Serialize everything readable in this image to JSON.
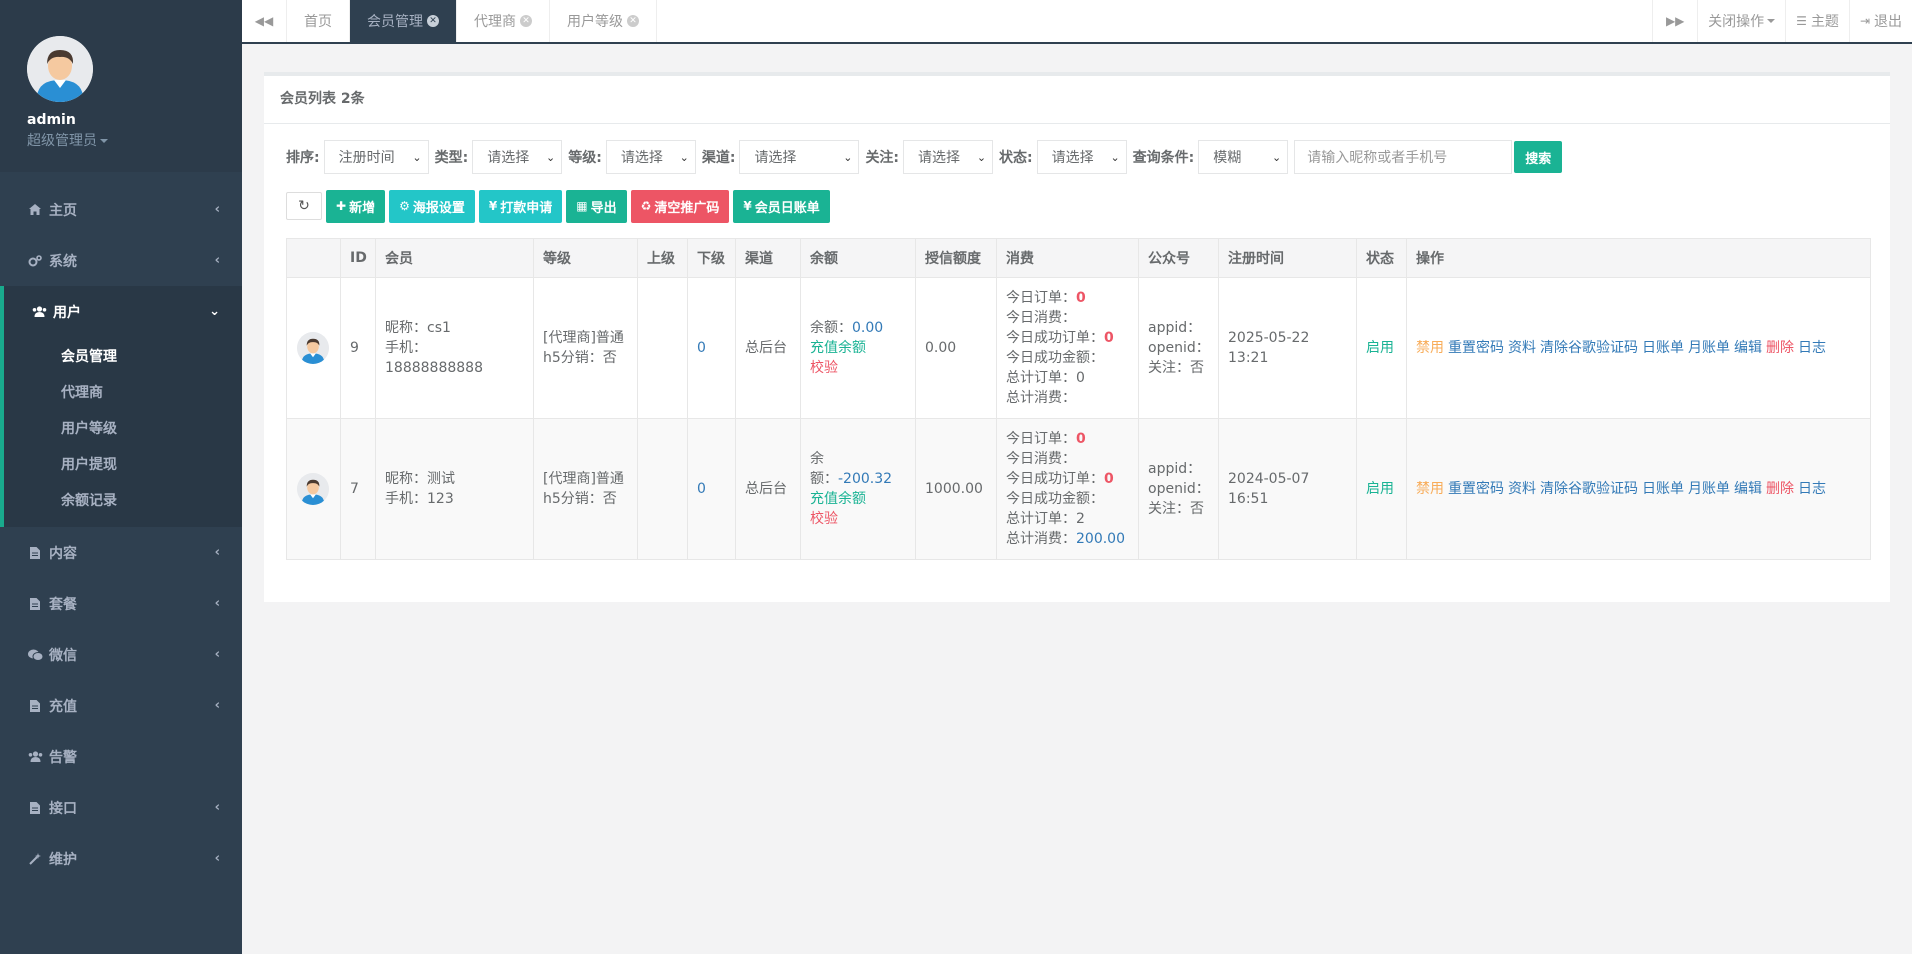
{
  "user": {
    "name": "admin",
    "role": "超级管理员"
  },
  "sidebar": {
    "items": [
      {
        "label": "主页",
        "icon": "home-icon"
      },
      {
        "label": "系统",
        "icon": "cogs-icon"
      },
      {
        "label": "用户",
        "icon": "users-icon"
      },
      {
        "label": "内容",
        "icon": "file-icon"
      },
      {
        "label": "套餐",
        "icon": "file-icon"
      },
      {
        "label": "微信",
        "icon": "wechat-icon"
      },
      {
        "label": "充值",
        "icon": "file-icon"
      },
      {
        "label": "告警",
        "icon": "users-icon"
      },
      {
        "label": "接口",
        "icon": "file-icon"
      },
      {
        "label": "维护",
        "icon": "wand-icon"
      }
    ],
    "submenu": [
      "会员管理",
      "代理商",
      "用户等级",
      "用户提现",
      "余额记录"
    ]
  },
  "tabs": [
    "首页",
    "会员管理",
    "代理商",
    "用户等级"
  ],
  "topbar": {
    "close_ops": "关闭操作",
    "theme": "主题",
    "logout": "退出"
  },
  "panel": {
    "title": "会员列表 2条"
  },
  "filters": {
    "sort_label": "排序:",
    "sort_value": "注册时间",
    "type_label": "类型:",
    "level_label": "等级:",
    "channel_label": "渠道:",
    "follow_label": "关注:",
    "status_label": "状态:",
    "query_label": "查询条件:",
    "query_value": "模糊",
    "placeholder_select": "请选择",
    "search_placeholder": "请输入昵称或者手机号",
    "search_button": "搜索"
  },
  "toolbar": {
    "add": "新增",
    "poster": "海报设置",
    "payout": "打款申请",
    "export": "导出",
    "clear_promo": "清空推广码",
    "daily_bill": "会员日账单"
  },
  "table": {
    "headers": [
      "ID",
      "会员",
      "等级",
      "上级",
      "下级",
      "渠道",
      "余额",
      "授信额度",
      "消费",
      "公众号",
      "注册时间",
      "状态",
      "操作"
    ],
    "rows": [
      {
        "id": "9",
        "nickname": "昵称：cs1",
        "phone": "手机：18888888888",
        "level_line1": "[代理商]普通",
        "level_line2": "h5分销：否",
        "parent": "",
        "children": "0",
        "channel": "总后台",
        "balance_label": "余额：",
        "balance": "0.00",
        "recharge": "充值余额",
        "verify": "校验",
        "credit": "0.00",
        "today_orders_label": "今日订单：",
        "today_orders": "0",
        "today_spend_label": "今日消费：",
        "today_spend": "",
        "today_success_label": "今日成功订单：",
        "today_success": "0",
        "today_success_amount_label": "今日成功金额：",
        "total_orders_label": "总计订单：",
        "total_orders": "0",
        "total_spend_label": "总计消费：",
        "total_spend": "",
        "appid": "appid：",
        "openid": "openid：",
        "follow": "关注：否",
        "reg_time": "2025-05-22 13:21",
        "status": "启用"
      },
      {
        "id": "7",
        "nickname": "昵称：测试",
        "phone": "手机：123",
        "level_line1": "[代理商]普通",
        "level_line2": "h5分销：否",
        "parent": "",
        "children": "0",
        "channel": "总后台",
        "balance_label": "余额：",
        "balance": "-200.32",
        "recharge": "充值余额",
        "verify": "校验",
        "credit": "1000.00",
        "today_orders_label": "今日订单：",
        "today_orders": "0",
        "today_spend_label": "今日消费：",
        "today_spend": "",
        "today_success_label": "今日成功订单：",
        "today_success": "0",
        "today_success_amount_label": "今日成功金额：",
        "total_orders_label": "总计订单：",
        "total_orders": "2",
        "total_spend_label": "总计消费：",
        "total_spend": "200.00",
        "appid": "appid：",
        "openid": "openid：",
        "follow": "关注：否",
        "reg_time": "2024-05-07 16:51",
        "status": "启用"
      }
    ],
    "ops": [
      "禁用",
      "重置密码",
      "资料",
      "清除谷歌验证码",
      "日账单",
      "月账单",
      "编辑",
      "删除",
      "日志"
    ]
  }
}
